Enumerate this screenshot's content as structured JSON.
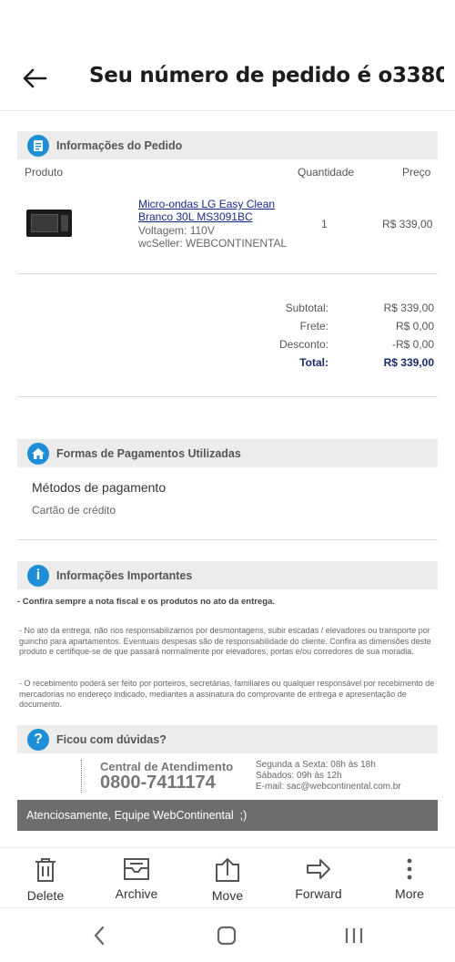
{
  "header": {
    "title": "Seu número de pedido é o3380..."
  },
  "order_info": {
    "section_title": "Informações do Pedido",
    "columns": [
      "Produto",
      "Quantidade",
      "Preço"
    ],
    "item": {
      "name": "Micro-ondas LG Easy Clean Branco 30L MS3091BC",
      "voltage": "Voltagem: 110V",
      "seller": "wcSeller: WEBCONTINENTAL",
      "quantity": "1",
      "price": "R$ 339,00"
    },
    "summary": [
      {
        "label": "Subtotal:",
        "value": "R$ 339,00"
      },
      {
        "label": "Frete:",
        "value": "R$ 0,00"
      },
      {
        "label": "Desconto:",
        "value": "-R$ 0,00"
      },
      {
        "label": "Total:",
        "value": "R$ 339,00"
      }
    ]
  },
  "payment": {
    "section_title": "Formas de Pagamentos Utilizadas",
    "methods_title": "Métodos de pagamento",
    "method": "Cartão de crédito"
  },
  "important": {
    "section_title": "Informações Importantes",
    "line1": "- Confira sempre a nota fiscal e os produtos no ato da entrega.",
    "para1": "- No ato da entrega, não nos responsabilizamos por desmontagens, subir escadas / elevadores ou transporte por guincho para apartamentos. Eventuais despesas são de responsabilidade do cliente. Confira as dimensões deste produto e certifique-se de que passará normalmente por elevadores, portas e/ou corredores de sua moradia.",
    "para2": "- O recebimento poderá ser feito por porteiros, secretárias, familiares ou qualquer responsável por recebimento de mercadorias no endereço indicado, mediantes a assinatura do comprovante de entrega e apresentação de documento."
  },
  "help": {
    "section_title": "Ficou com dúvidas?",
    "center_label": "Central de Atendimento",
    "phone": "0800-7411174",
    "hours1": "Segunda a Sexta: 08h às 18h",
    "hours2": "Sábados: 09h às 12h",
    "email": "E-mail: sac@webcontinental.com.br"
  },
  "footer": {
    "signoff": "Atenciosamente, Equipe WebContinental  ;)"
  },
  "actions": [
    {
      "label": "Delete",
      "icon": "trash-icon"
    },
    {
      "label": "Archive",
      "icon": "archive-icon"
    },
    {
      "label": "Move",
      "icon": "move-icon"
    },
    {
      "label": "Forward",
      "icon": "forward-arrow-icon"
    },
    {
      "label": "More",
      "icon": "more-vertical-icon"
    }
  ],
  "colors": {
    "accent_blue": "#1d8fd8",
    "link_blue": "#1a2a8c",
    "section_bg": "#ececec",
    "footer_bg": "#6d6d6d"
  }
}
